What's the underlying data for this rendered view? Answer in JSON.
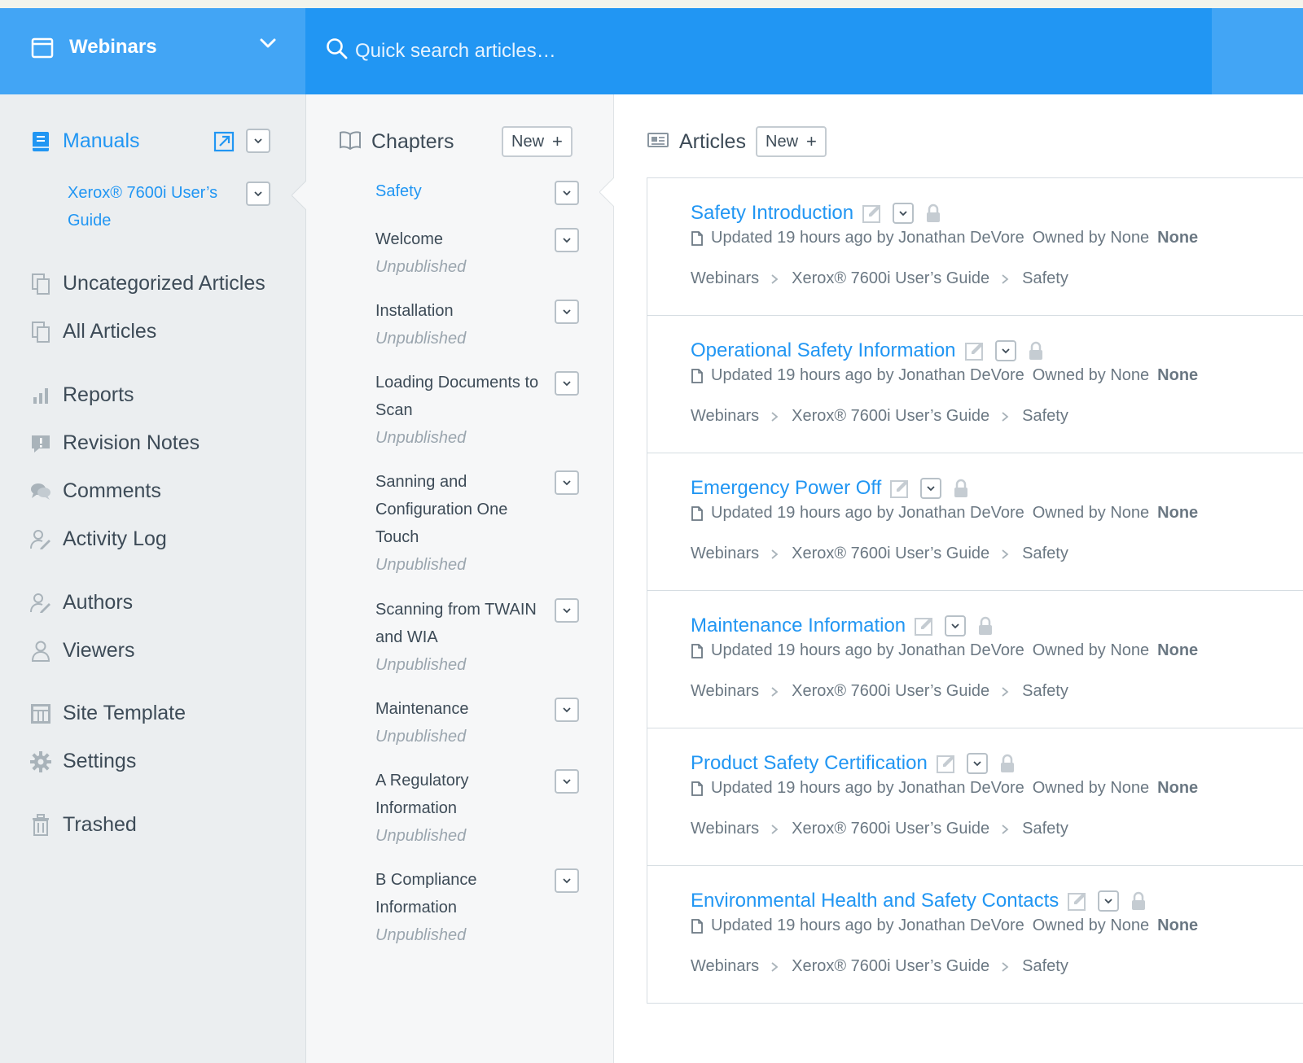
{
  "header": {
    "app_title": "Webinars",
    "search_placeholder": "Quick search articles…"
  },
  "sidebar": {
    "manuals_label": "Manuals",
    "manual_item": "Xerox® 7600i User’s Guide",
    "items": [
      {
        "label": "Uncategorized Articles",
        "icon": "copy-icon"
      },
      {
        "label": "All Articles",
        "icon": "copy-icon"
      },
      {
        "label": "Reports",
        "icon": "bar-chart-icon"
      },
      {
        "label": "Revision Notes",
        "icon": "alert-note-icon"
      },
      {
        "label": "Comments",
        "icon": "comments-icon"
      },
      {
        "label": "Activity Log",
        "icon": "user-edit-icon"
      },
      {
        "label": "Authors",
        "icon": "user-edit-icon"
      },
      {
        "label": "Viewers",
        "icon": "user-icon"
      },
      {
        "label": "Site Template",
        "icon": "template-icon"
      },
      {
        "label": "Settings",
        "icon": "gear-icon"
      },
      {
        "label": "Trashed",
        "icon": "trash-icon"
      }
    ]
  },
  "chapters": {
    "title": "Chapters",
    "new_label": "New",
    "items": [
      {
        "name": "Safety",
        "status": ""
      },
      {
        "name": "Welcome",
        "status": "Unpublished"
      },
      {
        "name": "Installation",
        "status": "Unpublished"
      },
      {
        "name": "Loading Documents to Scan",
        "status": "Unpublished"
      },
      {
        "name": "Sanning and Configuration One Touch",
        "status": "Unpublished"
      },
      {
        "name": "Scanning from TWAIN and WIA",
        "status": "Unpublished"
      },
      {
        "name": "Maintenance",
        "status": "Unpublished"
      },
      {
        "name": "A Regulatory Information",
        "status": "Unpublished"
      },
      {
        "name": "B Compliance Information",
        "status": "Unpublished"
      }
    ]
  },
  "articles": {
    "title": "Articles",
    "new_label": "New",
    "items": [
      {
        "title": "Safety Introduction",
        "updated": "Updated 19 hours ago by Jonathan DeVore",
        "owned": "Owned by None",
        "owner": "None",
        "crumbs": [
          "Webinars",
          "Xerox® 7600i User’s Guide",
          "Safety"
        ]
      },
      {
        "title": "Operational Safety Information",
        "updated": "Updated 19 hours ago by Jonathan DeVore",
        "owned": "Owned by None",
        "owner": "None",
        "crumbs": [
          "Webinars",
          "Xerox® 7600i User’s Guide",
          "Safety"
        ]
      },
      {
        "title": "Emergency Power Off",
        "updated": "Updated 19 hours ago by Jonathan DeVore",
        "owned": "Owned by None",
        "owner": "None",
        "crumbs": [
          "Webinars",
          "Xerox® 7600i User’s Guide",
          "Safety"
        ]
      },
      {
        "title": "Maintenance Information",
        "updated": "Updated 19 hours ago by Jonathan DeVore",
        "owned": "Owned by None",
        "owner": "None",
        "crumbs": [
          "Webinars",
          "Xerox® 7600i User’s Guide",
          "Safety"
        ]
      },
      {
        "title": "Product Safety Certification",
        "updated": "Updated 19 hours ago by Jonathan DeVore",
        "owned": "Owned by None",
        "owner": "None",
        "crumbs": [
          "Webinars",
          "Xerox® 7600i User’s Guide",
          "Safety"
        ]
      },
      {
        "title": "Environmental Health and Safety Contacts",
        "updated": "Updated 19 hours ago by Jonathan DeVore",
        "owned": "Owned by None",
        "owner": "None",
        "crumbs": [
          "Webinars",
          "Xerox® 7600i User’s Guide",
          "Safety"
        ]
      }
    ]
  },
  "colors": {
    "header_blue": "#2196f3",
    "header_left_blue": "#42a5f5",
    "link_blue": "#2196f3",
    "sidebar_bg": "#ebeef0"
  }
}
